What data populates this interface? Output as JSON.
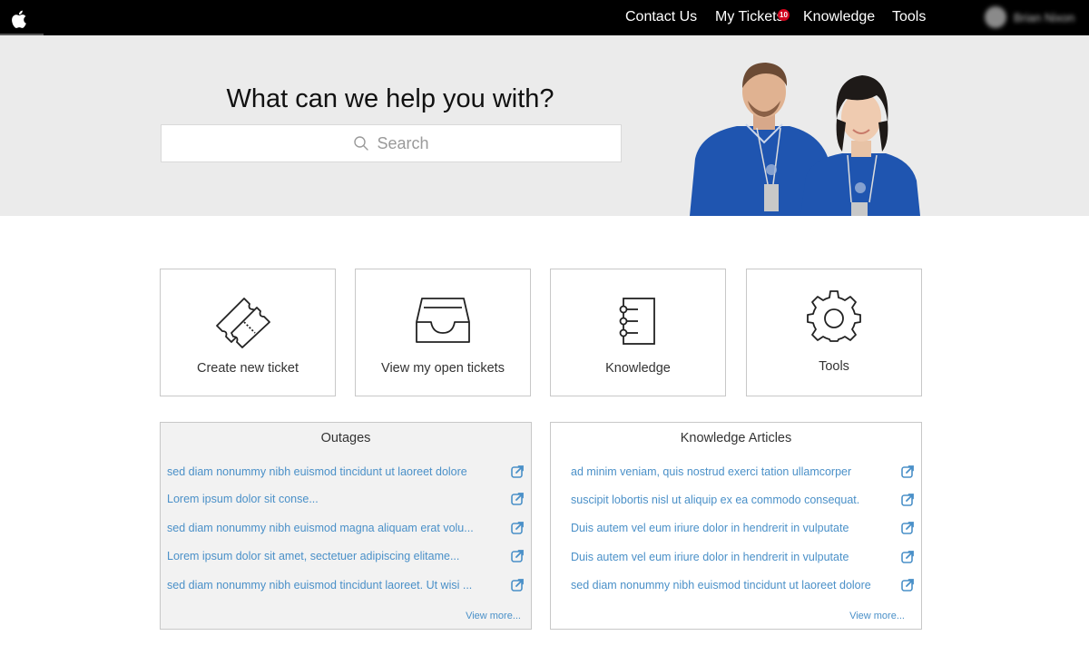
{
  "nav": {
    "links": [
      "Contact Us",
      "My Tickets",
      "Knowledge",
      "Tools"
    ],
    "tickets_badge": "10",
    "user_name": "Brian Nixon",
    "logo_icon": "apple-logo-icon"
  },
  "hero": {
    "title": "What can we help you with?",
    "search_placeholder": "Search",
    "search_icon": "search-icon",
    "image": "support-staff-photo"
  },
  "tiles": [
    {
      "label": "Create new ticket",
      "icon": "tickets-icon"
    },
    {
      "label": "View my open tickets",
      "icon": "inbox-tray-icon"
    },
    {
      "label": "Knowledge",
      "icon": "notebook-icon"
    },
    {
      "label": "Tools",
      "icon": "gear-icon"
    }
  ],
  "outages": {
    "title": "Outages",
    "items": [
      "sed diam nonummy nibh euismod tincidunt ut laoreet dolore",
      "Lorem ipsum dolor sit conse...",
      "sed diam nonummy nibh euismod magna aliquam erat volu...",
      "Lorem ipsum dolor sit amet, sectetuer adipiscing elitame...",
      "sed diam nonummy nibh euismod tincidunt laoreet. Ut wisi ..."
    ],
    "view_more": "View more..."
  },
  "knowledge_articles": {
    "title": "Knowledge Articles",
    "items": [
      "ad minim veniam, quis nostrud exerci tation ullamcorper",
      "suscipit lobortis nisl ut aliquip ex ea commodo consequat.",
      "Duis autem vel eum iriure dolor in hendrerit in vulputate",
      "Duis autem vel eum iriure dolor in hendrerit in vulputate",
      "sed diam nonummy nibh euismod tincidunt ut laoreet dolore"
    ],
    "view_more": "View more..."
  },
  "colors": {
    "nav_bg": "#000000",
    "hero_bg": "#ebebeb",
    "link": "#4a90c8",
    "badge": "#d0021b",
    "outages_bg": "#f2f2f2",
    "shirt_blue": "#1f55b0"
  }
}
